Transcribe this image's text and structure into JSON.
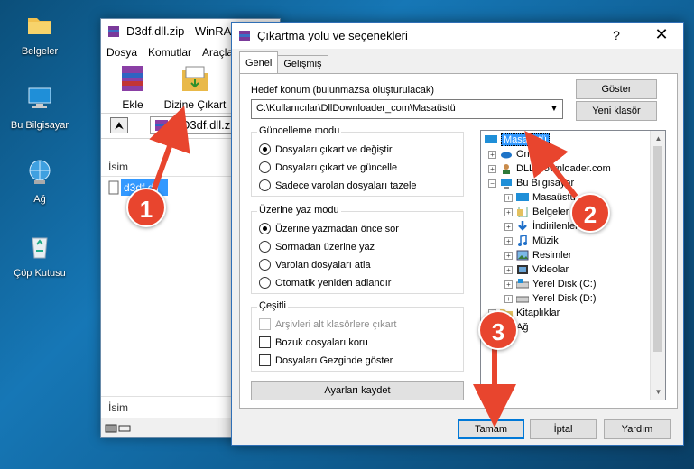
{
  "desktop": {
    "icons": [
      {
        "label": "Belgeler",
        "icon": "folder-icon"
      },
      {
        "label": "Bu Bilgisayar",
        "icon": "computer-icon"
      },
      {
        "label": "Ağ",
        "icon": "network-icon"
      },
      {
        "label": "Çöp Kutusu",
        "icon": "recycle-bin-icon"
      }
    ]
  },
  "winrar": {
    "title": "D3df.dll.zip - WinRAR",
    "menu": [
      "Dosya",
      "Komutlar",
      "Araçlar"
    ],
    "toolbar": {
      "add_label": "Ekle",
      "extract_label": "Dizine Çıkart"
    },
    "path_value": "D3df.dll.zip",
    "list_header": "İsim",
    "file_name": "d3df.dll",
    "list_footer": "İsim"
  },
  "dialog": {
    "title": "Çıkartma yolu ve seçenekleri",
    "help": "?",
    "close": "✕",
    "tabs": [
      "Genel",
      "Gelişmiş"
    ],
    "dest_label": "Hedef konum (bulunmazsa oluşturulacak)",
    "dest_value": "C:\\Kullanıcılar\\DllDownloader_com\\Masaüstü",
    "show_button": "Göster",
    "new_folder_button": "Yeni klasör",
    "update_mode": {
      "title": "Güncelleme modu",
      "options": [
        "Dosyaları çıkart ve değiştir",
        "Dosyaları çıkart ve güncelle",
        "Sadece varolan dosyaları tazele"
      ],
      "selected": 0
    },
    "overwrite_mode": {
      "title": "Üzerine yaz modu",
      "options": [
        "Üzerine yazmadan önce sor",
        "Sormadan üzerine yaz",
        "Varolan dosyaları atla",
        "Otomatik yeniden adlandır"
      ],
      "selected": 0
    },
    "misc": {
      "title": "Çeşitli",
      "options": [
        {
          "label": "Arşivleri alt klasörlere çıkart",
          "checked": false,
          "disabled": true
        },
        {
          "label": "Bozuk dosyaları koru",
          "checked": false,
          "disabled": false
        },
        {
          "label": "Dosyaları Gezginde göster",
          "checked": false,
          "disabled": false
        }
      ]
    },
    "save_settings_button": "Ayarları kaydet",
    "tree": [
      {
        "label": "Masaüstü",
        "level": 0,
        "expander": "",
        "selected": true,
        "icon": "desktop-icon"
      },
      {
        "label": "OneDrive",
        "level": 1,
        "expander": "+",
        "icon": "cloud-icon"
      },
      {
        "label": "DLL Downloader.com",
        "level": 1,
        "expander": "+",
        "icon": "user-icon"
      },
      {
        "label": "Bu Bilgisayar",
        "level": 1,
        "expander": "−",
        "icon": "computer-icon"
      },
      {
        "label": "Masaüstü",
        "level": 2,
        "expander": "+",
        "icon": "desktop-icon"
      },
      {
        "label": "Belgeler",
        "level": 2,
        "expander": "+",
        "icon": "documents-icon"
      },
      {
        "label": "İndirilenler",
        "level": 2,
        "expander": "+",
        "icon": "download-icon"
      },
      {
        "label": "Müzik",
        "level": 2,
        "expander": "+",
        "icon": "music-icon"
      },
      {
        "label": "Resimler",
        "level": 2,
        "expander": "+",
        "icon": "pictures-icon"
      },
      {
        "label": "Videolar",
        "level": 2,
        "expander": "+",
        "icon": "videos-icon"
      },
      {
        "label": "Yerel Disk (C:)",
        "level": 2,
        "expander": "+",
        "icon": "drive-icon"
      },
      {
        "label": "Yerel Disk (D:)",
        "level": 2,
        "expander": "+",
        "icon": "drive-icon"
      },
      {
        "label": "Kitaplıklar",
        "level": 1,
        "expander": "+",
        "icon": "libraries-icon"
      },
      {
        "label": "Ağ",
        "level": 1,
        "expander": "+",
        "icon": "network-icon"
      }
    ],
    "ok_button": "Tamam",
    "cancel_button": "İptal",
    "help_button": "Yardım"
  },
  "callouts": [
    "1",
    "2",
    "3"
  ],
  "colors": {
    "accent": "#3399ff",
    "callout": "#e8452e"
  }
}
